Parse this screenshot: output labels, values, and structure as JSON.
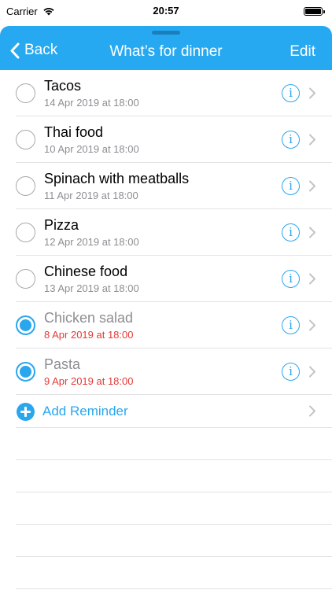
{
  "status_bar": {
    "carrier": "Carrier",
    "time": "20:57"
  },
  "nav": {
    "back_label": "Back",
    "title": "What’s for dinner",
    "edit_label": "Edit",
    "color": "#26a9f1"
  },
  "reminders": [
    {
      "title": "Tacos",
      "date": "14 Apr 2019 at 18:00",
      "completed": false
    },
    {
      "title": "Thai food",
      "date": "10 Apr 2019 at 18:00",
      "completed": false
    },
    {
      "title": "Spinach with meatballs",
      "date": "11 Apr 2019 at 18:00",
      "completed": false
    },
    {
      "title": "Pizza",
      "date": "12 Apr 2019 at 18:00",
      "completed": false
    },
    {
      "title": "Chinese food",
      "date": "13 Apr 2019 at 18:00",
      "completed": false
    },
    {
      "title": "Chicken salad",
      "date": "8 Apr 2019 at 18:00",
      "completed": true
    },
    {
      "title": "Pasta",
      "date": "9 Apr 2019 at 18:00",
      "completed": true
    }
  ],
  "add_reminder": {
    "label": "Add Reminder"
  },
  "colors": {
    "accent": "#2aa6ee",
    "overdue": "#e53935",
    "secondary_text": "#8e8e93"
  }
}
